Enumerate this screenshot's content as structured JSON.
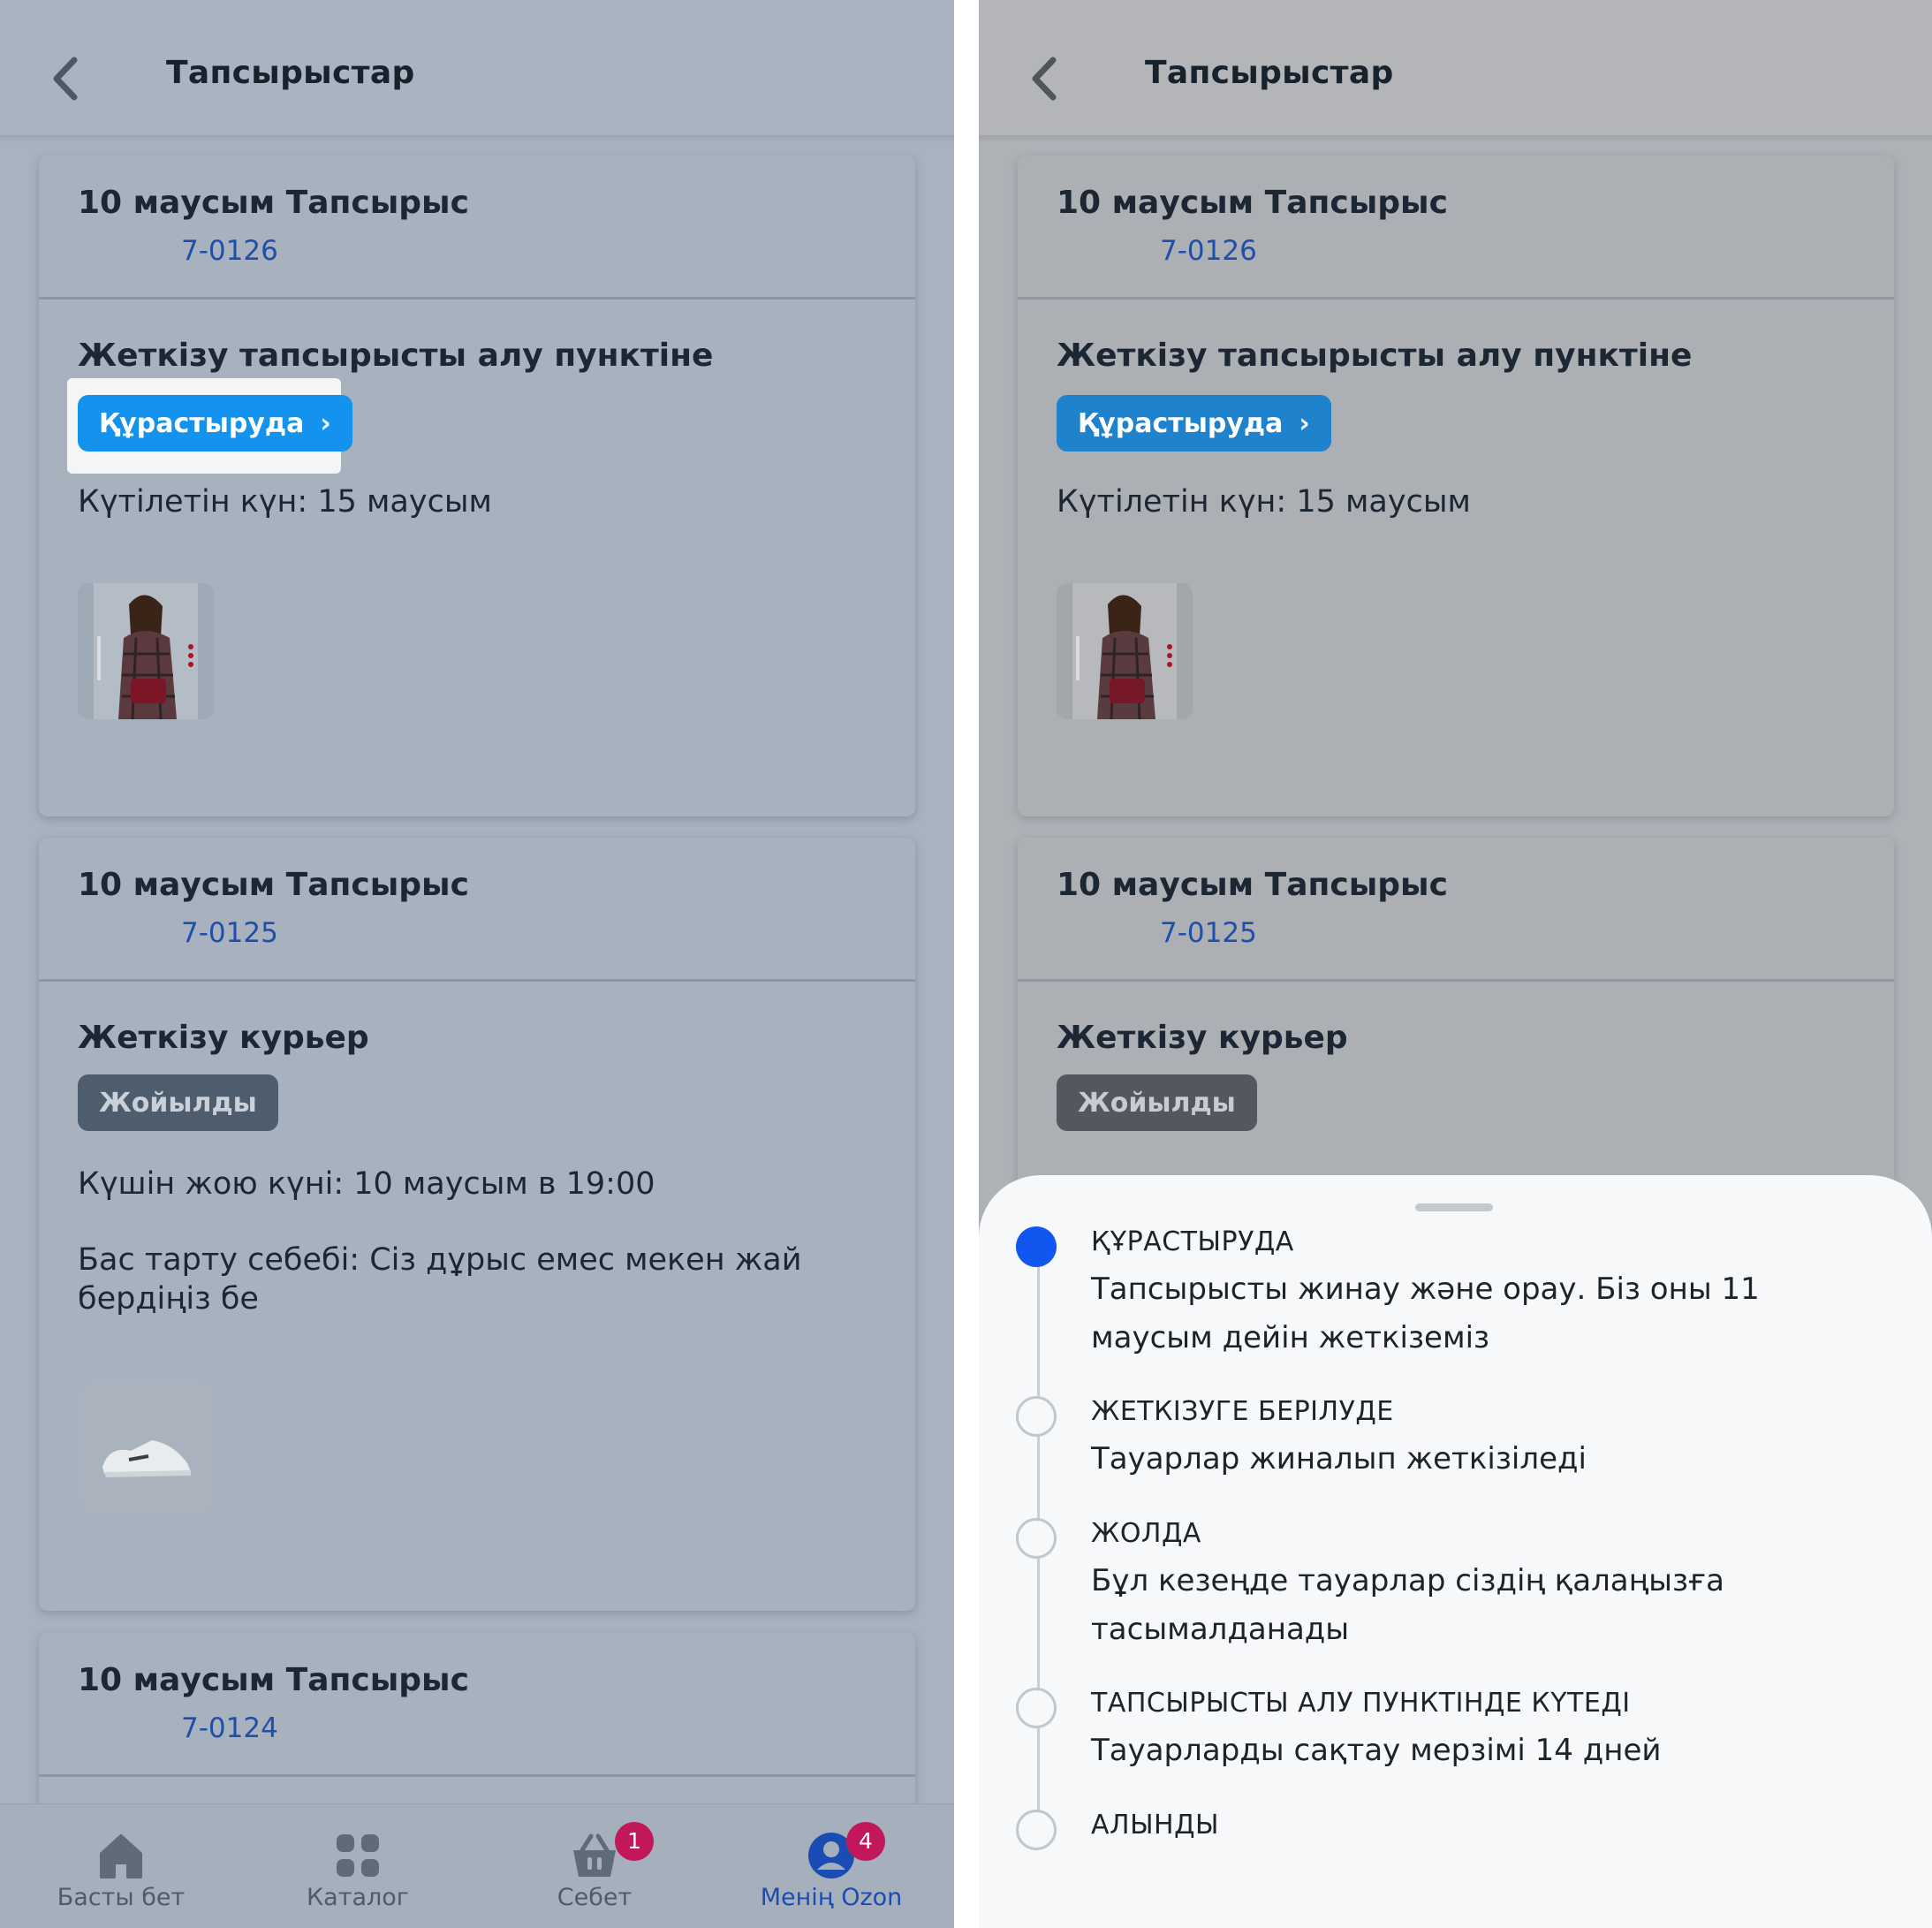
{
  "header": {
    "title": "Тапсырыстар"
  },
  "orders": [
    {
      "title": "10 маусым Тапсырыс",
      "number": "7-0126",
      "delivery": "Жеткізу тапсырысты алу пунктіне",
      "status": "Құрастыруда",
      "expected": "Күтілетін күн: 15 маусым"
    },
    {
      "title": "10 маусым Тапсырыс",
      "number": "7-0125",
      "delivery": "Жеткізу курьер",
      "status": "Жойылды",
      "cancel_date": "Күшін жою күні: 10 маусым в 19:00",
      "cancel_reason": "Бас тарту себебі: Сіз дұрыс емес мекен жай бердіңіз бе"
    },
    {
      "title": "10 маусым Тапсырыс",
      "number": "7-0124"
    }
  ],
  "bottom_nav": [
    {
      "label": "Басты бет",
      "icon": "home-icon"
    },
    {
      "label": "Каталог",
      "icon": "catalog-icon"
    },
    {
      "label": "Себет",
      "icon": "cart-icon",
      "badge": "1"
    },
    {
      "label": "Менің Ozon",
      "icon": "profile-icon",
      "badge": "4",
      "active": true
    }
  ],
  "status_sheet": {
    "steps": [
      {
        "title": "ҚҰРАСТЫРУДА",
        "desc": "Тапсырысты жинау және орау. Біз оны 11 маусым дейін жеткіземіз",
        "active": true
      },
      {
        "title": "ЖЕТКІЗУГЕ БЕРІЛУДЕ",
        "desc": "Тауарлар жиналып жеткізіледі"
      },
      {
        "title": "ЖОЛДА",
        "desc": "Бұл кезеңде тауарлар сіздің қалаңызға тасымалданады"
      },
      {
        "title": "ТАПСЫРЫСТЫ АЛУ ПУНКТІНДЕ КҮТЕДІ",
        "desc": "Тауарларды сақтау мерзімі 14 дней"
      },
      {
        "title": "АЛЫНДЫ"
      }
    ]
  },
  "colors": {
    "accent_blue": "#1493ee",
    "timeline_active": "#1157ef",
    "badge": "#c2185b",
    "link": "#1f4fa8"
  }
}
